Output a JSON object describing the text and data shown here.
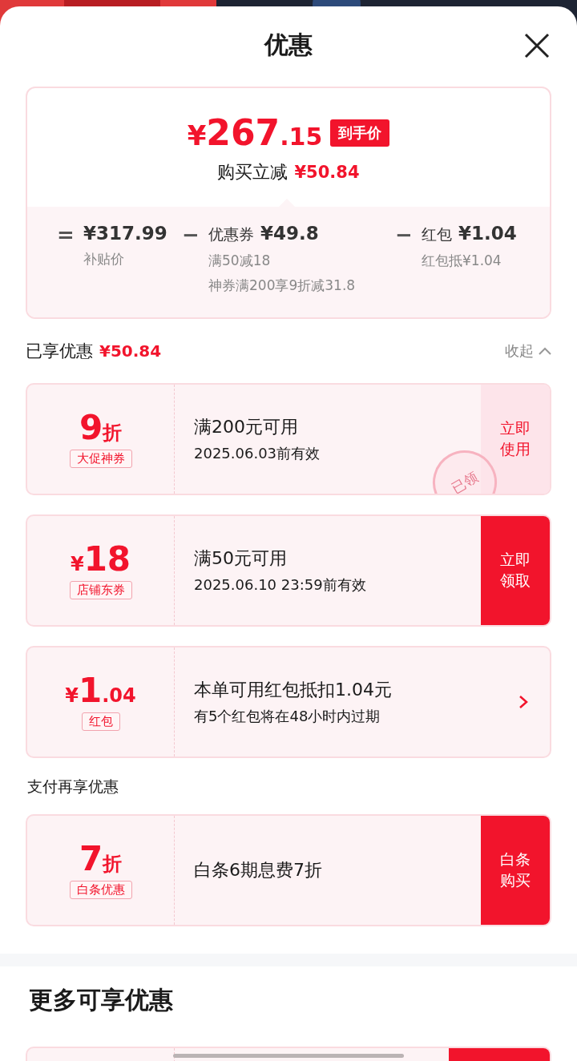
{
  "header": {
    "title": "优惠"
  },
  "summary": {
    "currency": "¥",
    "price_integer": "267",
    "price_decimal": ".15",
    "price_tag": "到手价",
    "reduction_label": "购买立减",
    "reduction": "¥50.84",
    "breakdown": [
      {
        "operator": "=",
        "value": "¥317.99",
        "notes": [
          "补贴价"
        ]
      },
      {
        "operator": "−",
        "label": "优惠券",
        "value": "¥49.8",
        "notes": [
          "满50减18",
          "神券满200享9折减31.8"
        ]
      },
      {
        "operator": "−",
        "label": "红包",
        "value": "¥1.04",
        "notes": [
          "红包抵¥1.04"
        ]
      }
    ]
  },
  "enjoyed": {
    "label": "已享优惠",
    "amount": "¥50.84",
    "toggle": "收起",
    "expanded": true
  },
  "coupons": [
    {
      "value": "9",
      "value_suffix": "折",
      "tag": "大促神券",
      "condition": "满200元可用",
      "validity": "2025.06.03前有效",
      "action": {
        "kind": "button",
        "label": "立即使用"
      },
      "stamp": "已领"
    },
    {
      "value_prefix": "¥",
      "value": "18",
      "tag": "店铺东券",
      "condition": "满50元可用",
      "validity": "2025.06.10 23:59前有效",
      "action": {
        "kind": "button",
        "label": "立即领取"
      }
    },
    {
      "value_prefix": "¥",
      "value": "1",
      "value_suffix": ".04",
      "tag": "红包",
      "condition": "本单可用红包抵扣1.04元",
      "validity": "有5个红包将在48小时内过期",
      "action": {
        "kind": "arrow"
      }
    }
  ],
  "pay_section": {
    "title": "支付再享优惠"
  },
  "pay_coupons": [
    {
      "value": "7",
      "value_suffix": "折",
      "tag": "白条优惠",
      "condition": "白条6期息费7折",
      "action": {
        "kind": "button",
        "label": "白条购买"
      }
    }
  ],
  "more": {
    "title": "更多可享优惠"
  }
}
